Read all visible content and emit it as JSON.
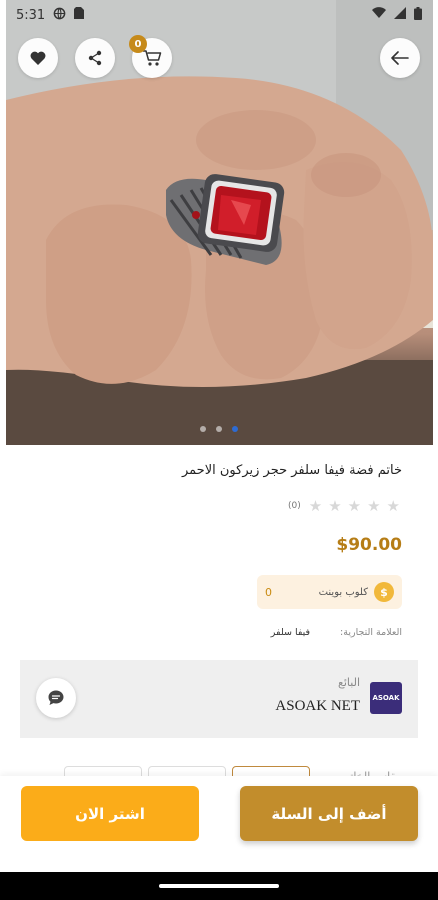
{
  "status_bar": {
    "time": "5:31"
  },
  "header": {
    "cart_count": "0"
  },
  "gallery": {
    "dots": 3,
    "active_dot": 2
  },
  "product": {
    "title": "خاتم فضة فيفا سلفر حجر زيركون الاحمر",
    "rating_count": "(0)",
    "stars": 5,
    "price": "$90.00",
    "points_label": "كلوب بوينت",
    "points_value": "0",
    "brand_label": "العلامة التجارية:",
    "brand_value": "فيفا سلفر"
  },
  "seller": {
    "label": "البائع",
    "name": "ASOAK NET",
    "logo_text": "ASOAK"
  },
  "options": {
    "size_label": "مقاس الخاتم"
  },
  "actions": {
    "add_to_cart": "أضف إلى السلة",
    "buy_now": "اشتر الان"
  },
  "colors": {
    "accent": "#c28d2c",
    "buy": "#fbac19",
    "price": "#b67d16"
  }
}
